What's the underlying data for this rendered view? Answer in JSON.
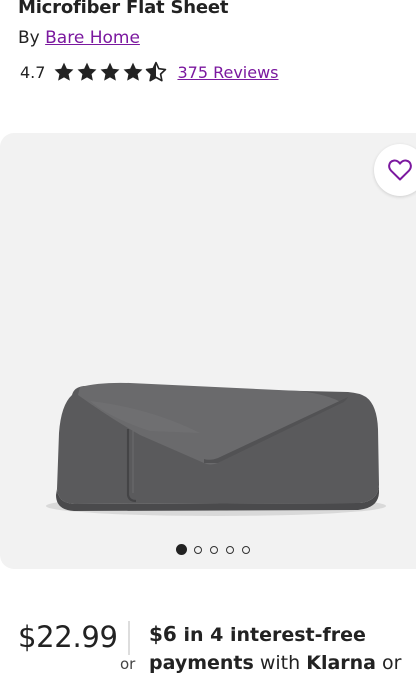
{
  "product": {
    "title": "Microfiber Flat Sheet",
    "by_label": "By",
    "brand": "Bare Home",
    "rating_value": "4.7",
    "rating_stars": 4.5,
    "reviews_label": "375 Reviews"
  },
  "gallery": {
    "image_count": 5,
    "active_index": 0,
    "favorite_icon": "heart-outline-icon"
  },
  "pricing": {
    "price": "$22.99",
    "installment_amount": "$6",
    "installment_text": " in 4 interest-free",
    "or_text": "or",
    "installment_line2_bold": "payments",
    "installment_line2_with": " with ",
    "installment_provider": "Klarna",
    "installment_line2_tail": " or"
  },
  "colors": {
    "link": "#7b189f",
    "star": "#222222",
    "gallery_bg": "#f2f2f2"
  }
}
